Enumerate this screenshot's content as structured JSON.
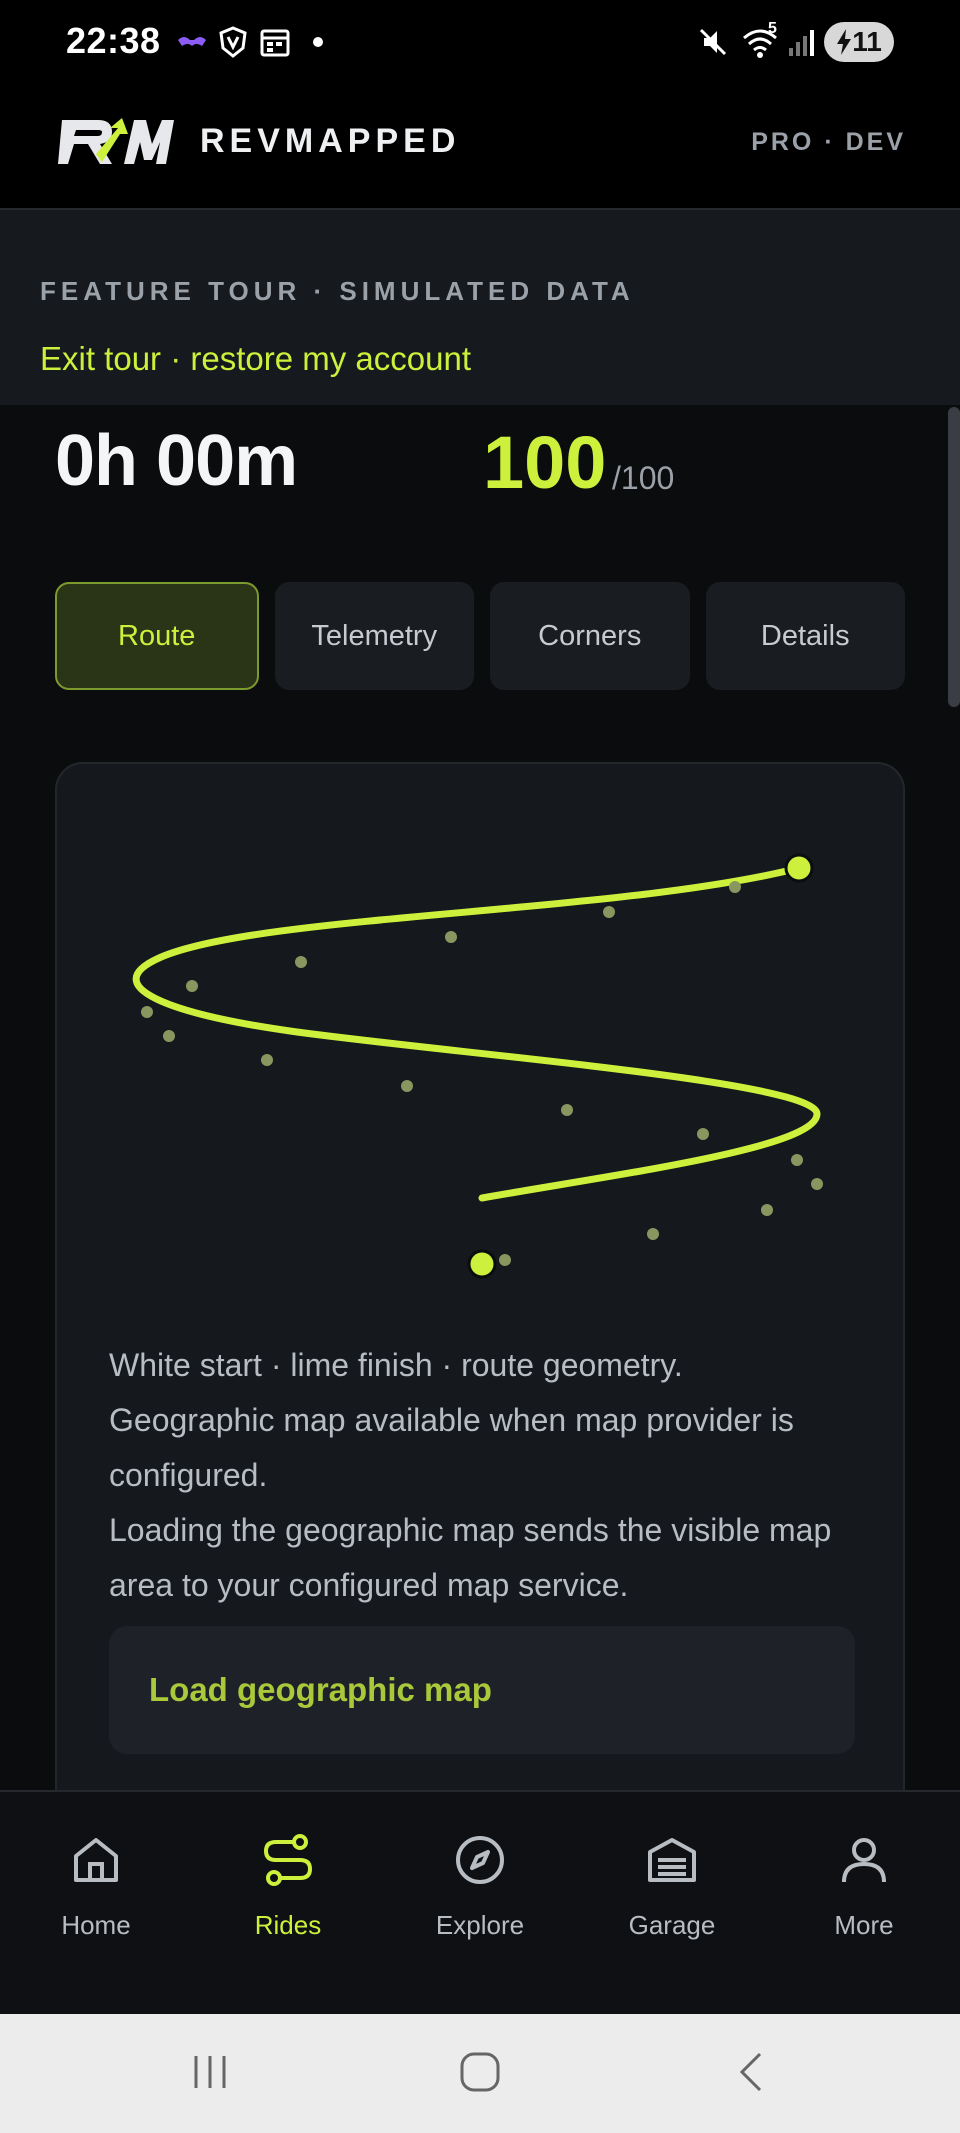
{
  "status_bar": {
    "time": "22:38",
    "icons": [
      "app-notification-icon",
      "vpn-shield-icon",
      "calendar-icon",
      "dot-icon",
      "mute-icon",
      "wifi-icon",
      "signal-icon"
    ],
    "wifi_label": "5",
    "battery_level": "11"
  },
  "header": {
    "logo_text": "RM",
    "brand": "REVMAPPED",
    "plan_badge": "PRO · DEV"
  },
  "tour": {
    "label": "FEATURE TOUR · SIMULATED DATA",
    "exit_link": "Exit tour · restore my account"
  },
  "stats": {
    "duration": "0h 00m",
    "score": "100",
    "score_max": "/100"
  },
  "tabs": [
    {
      "label": "Route",
      "active": true
    },
    {
      "label": "Telemetry",
      "active": false
    },
    {
      "label": "Corners",
      "active": false
    },
    {
      "label": "Details",
      "active": false
    }
  ],
  "route": {
    "description_1": "White start · lime finish · route geometry.",
    "description_2": "Geographic map available when map provider is configured.",
    "description_3": "Loading the geographic map sends the visible map area to your configured map service.",
    "load_button": "Load geographic map",
    "colors": {
      "path": "#ccf03b",
      "marker": "#ccf03b",
      "waypoint": "#8a9660"
    }
  },
  "nav": [
    {
      "label": "Home",
      "icon": "home-icon",
      "active": false
    },
    {
      "label": "Rides",
      "icon": "route-icon",
      "active": true
    },
    {
      "label": "Explore",
      "icon": "compass-icon",
      "active": false
    },
    {
      "label": "Garage",
      "icon": "garage-icon",
      "active": false
    },
    {
      "label": "More",
      "icon": "person-icon",
      "active": false
    }
  ],
  "system_nav": [
    "recent-apps-icon",
    "home-circle-icon",
    "back-icon"
  ],
  "colors": {
    "accent": "#ccf03b",
    "background": "#0b0c0e",
    "surface": "#15181c",
    "muted_text": "#9ba1a8"
  }
}
